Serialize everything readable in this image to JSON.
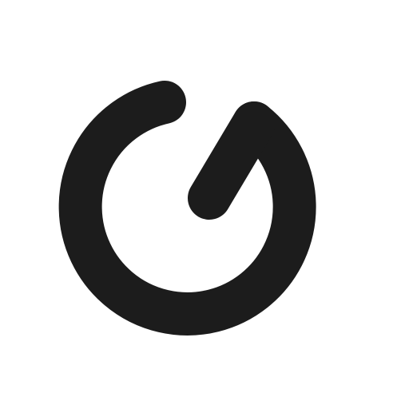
{
  "logo": {
    "icon": "circular-arrow-logo-icon",
    "color": "#1c1c1c",
    "background": "#ffffff"
  }
}
